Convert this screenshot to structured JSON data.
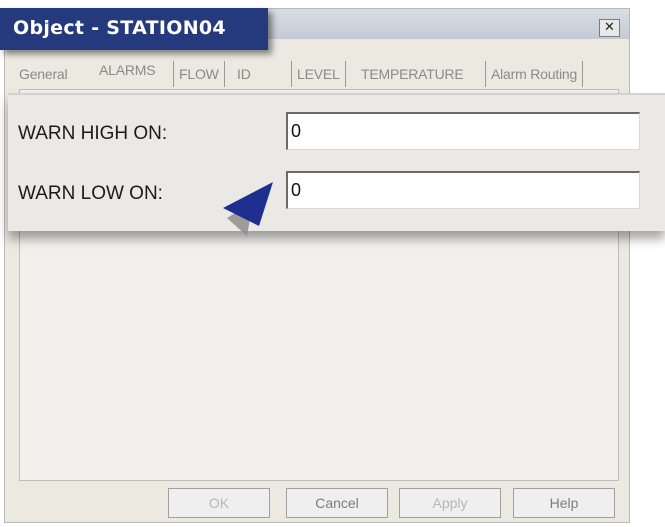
{
  "window": {
    "title": "Object - STATION04",
    "close_glyph": "✕"
  },
  "tabs": [
    {
      "label": "General"
    },
    {
      "label": "ALARMS"
    },
    {
      "label": "FLOW"
    },
    {
      "label": "ID"
    },
    {
      "label": "LEVEL"
    },
    {
      "label": "TEMPERATURE"
    },
    {
      "label": "Alarm Routing"
    }
  ],
  "fields": {
    "warn_high": {
      "label": "WARN HIGH ON:",
      "value": "0"
    },
    "warn_low": {
      "label": "WARN LOW ON:",
      "value": "0"
    }
  },
  "buttons": {
    "ok": "OK",
    "cancel": "Cancel",
    "apply": "Apply",
    "help": "Help"
  },
  "pointer": {
    "icon": "arrow-pointer-icon",
    "color": "#1f2f8f"
  }
}
